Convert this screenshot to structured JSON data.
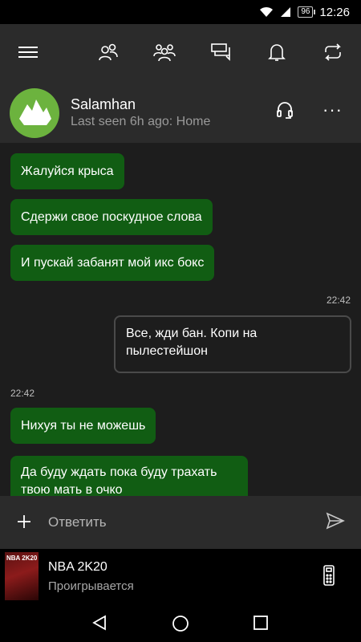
{
  "status_bar": {
    "time": "12:26",
    "battery": "96"
  },
  "contact": {
    "name": "Salamhan",
    "status": "Last seen 6h ago: Home"
  },
  "header": {
    "more_label": "···"
  },
  "messages": [
    {
      "dir": "in",
      "text": "Жалуйся крыса"
    },
    {
      "dir": "in",
      "text": "Сдержи свое поскудное слова"
    },
    {
      "dir": "in",
      "text": "И пускай забанят мой икс бокс"
    },
    {
      "dir": "time-right",
      "text": "22:42"
    },
    {
      "dir": "out",
      "text": "Все, жди бан. Копи на пылестейшон"
    },
    {
      "dir": "time-left",
      "text": "22:42"
    },
    {
      "dir": "in",
      "text": "Нихуя ты не можешь"
    },
    {
      "dir": "in",
      "text": "Да буду ждать пока буду трахать твою мать в очко"
    }
  ],
  "composer": {
    "placeholder": "Ответить"
  },
  "now_playing": {
    "art_label": "NBA 2K20",
    "title": "NBA 2K20",
    "subtitle": "Проигрывается"
  },
  "colors": {
    "accent": "#115d13",
    "avatar": "#6cb33e",
    "background": "#1d1d1d",
    "bar": "#2b2b2b"
  }
}
